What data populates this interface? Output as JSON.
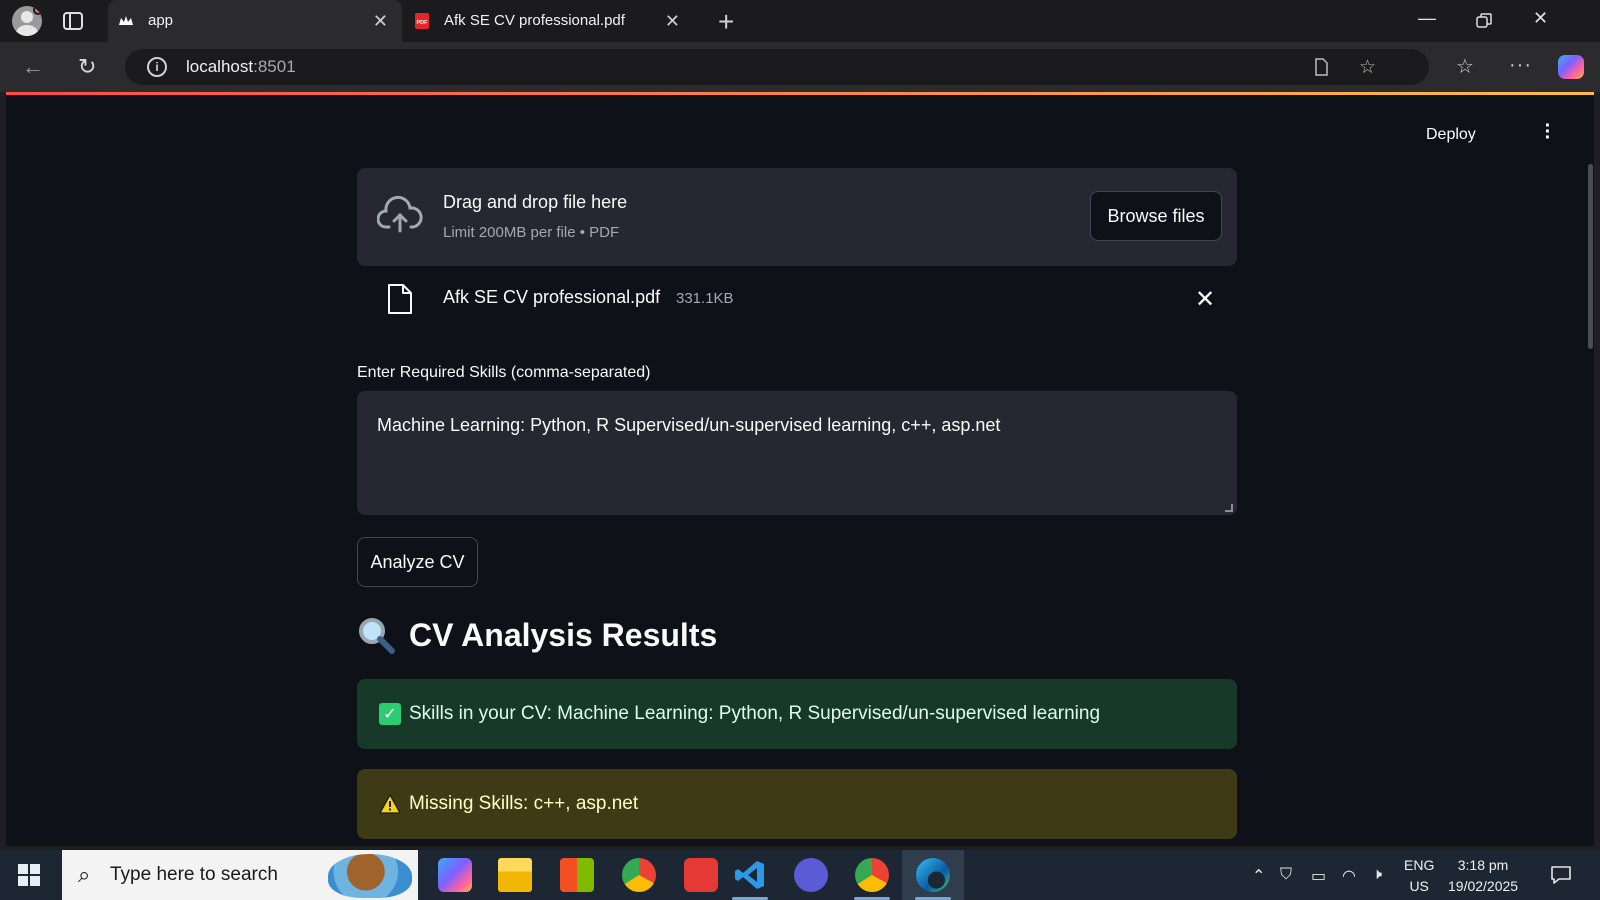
{
  "browser": {
    "tabs": [
      {
        "title": "app",
        "active": true,
        "favicon": "streamlit-crown-icon"
      },
      {
        "title": "Afk SE CV professional.pdf",
        "active": false,
        "favicon": "pdf-icon"
      }
    ],
    "url_host": "localhost",
    "url_port": ":8501"
  },
  "app": {
    "toolbar": {
      "deploy_label": "Deploy",
      "menu_icon": "more-vert-icon"
    },
    "uploader": {
      "title": "Drag and drop file here",
      "subtitle": "Limit 200MB per file • PDF",
      "browse_label": "Browse files"
    },
    "uploaded_file": {
      "name": "Afk SE CV professional.pdf",
      "size": "331.1KB"
    },
    "skills": {
      "label": "Enter Required Skills (comma-separated)",
      "value": "Machine Learning: Python, R Supervised/un-supervised learning, c++, asp.net"
    },
    "analyze_label": "Analyze CV",
    "results": {
      "heading": "CV Analysis Results",
      "success": "Skills in your CV: Machine Learning: Python, R Supervised/un-supervised learning",
      "warning": "Missing Skills: c++, asp.net"
    }
  },
  "taskbar": {
    "search_placeholder": "Type here to search",
    "lang_line1": "ENG",
    "lang_line2": "US",
    "time": "3:18 pm",
    "date": "19/02/2025"
  },
  "colors": {
    "app_bg": "#0e1117",
    "widget_bg": "#262730",
    "success_bg": "#173928",
    "warning_bg": "#3e3a16"
  }
}
